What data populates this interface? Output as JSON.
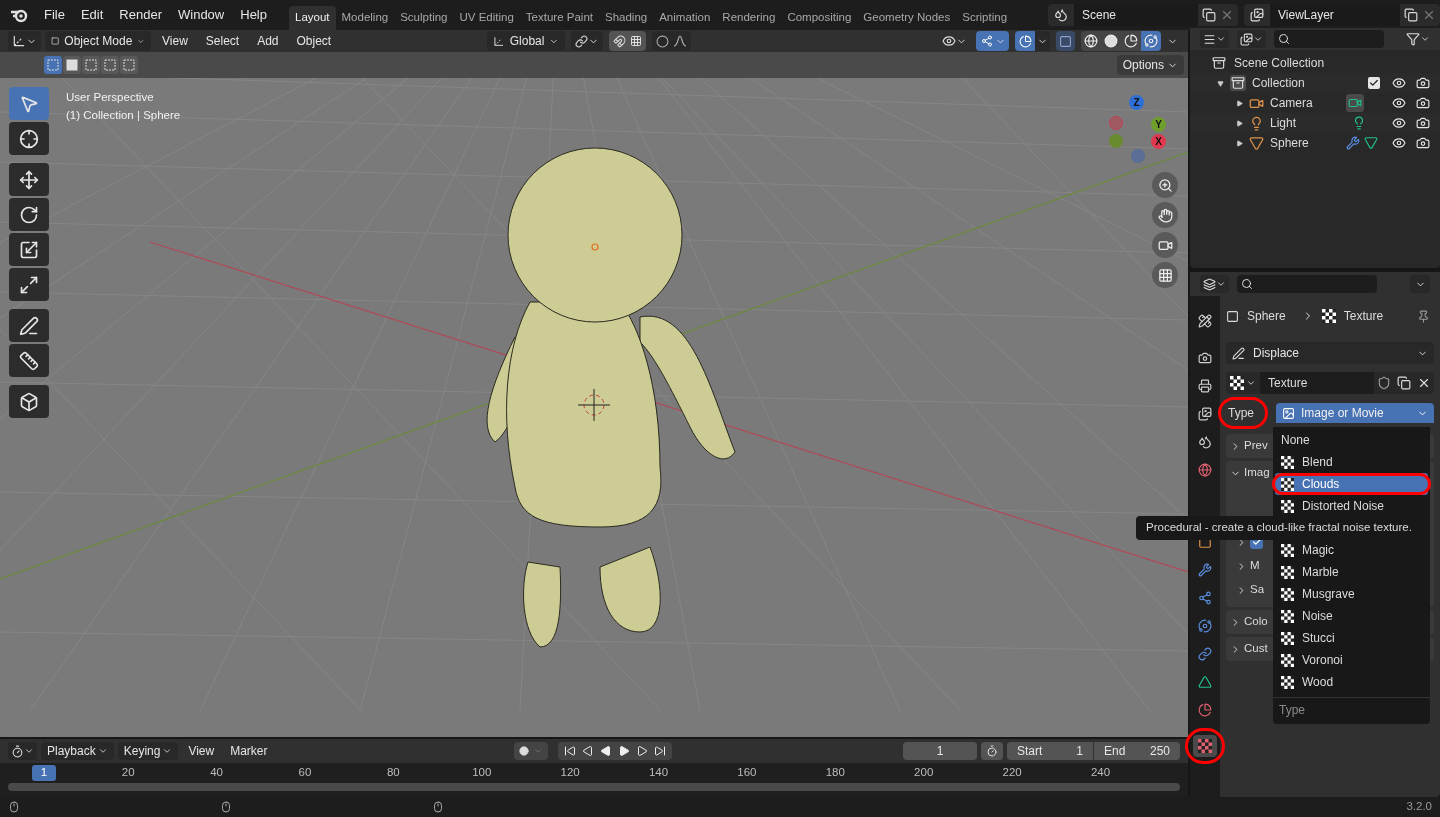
{
  "menu_bar": {
    "menus": [
      "File",
      "Edit",
      "Render",
      "Window",
      "Help"
    ],
    "workspaces": [
      {
        "label": "Layout",
        "selected": true
      },
      {
        "label": "Modeling",
        "selected": false
      },
      {
        "label": "Sculpting",
        "selected": false
      },
      {
        "label": "UV Editing",
        "selected": false
      },
      {
        "label": "Texture Paint",
        "selected": false
      },
      {
        "label": "Shading",
        "selected": false
      },
      {
        "label": "Animation",
        "selected": false
      },
      {
        "label": "Rendering",
        "selected": false
      },
      {
        "label": "Compositing",
        "selected": false
      },
      {
        "label": "Geometry Nodes",
        "selected": false
      },
      {
        "label": "Scripting",
        "selected": false
      }
    ],
    "scene": "Scene",
    "view_layer": "ViewLayer"
  },
  "viewport_header": {
    "mode": "Object Mode",
    "menus": [
      "View",
      "Select",
      "Add",
      "Object"
    ],
    "orientation": "Global",
    "snap_on": true,
    "gizmos_on": true,
    "overlays_on": true,
    "shading_modes": [
      {
        "kind": "wireframe",
        "selected": false
      },
      {
        "kind": "solid",
        "selected": false
      },
      {
        "kind": "material",
        "selected": false
      },
      {
        "kind": "rendered",
        "selected": true
      }
    ]
  },
  "tool_header": {
    "select_modes": [
      {
        "selected": true
      },
      {
        "selected": false
      },
      {
        "selected": false
      },
      {
        "selected": false
      },
      {
        "selected": false
      }
    ],
    "options": "Options"
  },
  "viewport": {
    "overlay_lines": [
      "User Perspective",
      "(1) Collection | Sphere"
    ],
    "gizmo_axes": [
      {
        "label": "Z",
        "color": "#2e6fd6"
      },
      {
        "label": "Y",
        "color": "#6f9e2b"
      },
      {
        "label": "X",
        "color": "#e0394f"
      }
    ],
    "tools": [
      {
        "kind": "select",
        "selected": true
      },
      {
        "kind": "cursor",
        "selected": false
      },
      {
        "kind": "move",
        "selected": false
      },
      {
        "kind": "rotate",
        "selected": false
      },
      {
        "kind": "scale",
        "selected": false
      },
      {
        "kind": "transform",
        "selected": false
      },
      {
        "kind": "annotate",
        "selected": false
      },
      {
        "kind": "measure",
        "selected": false
      },
      {
        "kind": "add-cube",
        "selected": false
      }
    ]
  },
  "outliner": {
    "scene_collection": "Scene Collection",
    "collection": {
      "label": "Collection",
      "expanded": true,
      "checked": true,
      "children": [
        {
          "label": "Camera",
          "kind": "camera"
        },
        {
          "label": "Light",
          "kind": "light"
        },
        {
          "label": "Sphere",
          "kind": "mesh"
        }
      ]
    }
  },
  "properties": {
    "tabs": [
      {
        "kind": "tool",
        "selected": false,
        "highlighted": false
      },
      {
        "kind": "render",
        "selected": false,
        "highlighted": false
      },
      {
        "kind": "output",
        "selected": false,
        "highlighted": false
      },
      {
        "kind": "view-layer",
        "selected": false,
        "highlighted": false
      },
      {
        "kind": "scene",
        "selected": false,
        "highlighted": false
      },
      {
        "kind": "world",
        "selected": false,
        "highlighted": false
      },
      {
        "kind": "object",
        "selected": false,
        "highlighted": false
      },
      {
        "kind": "modifier",
        "selected": false,
        "highlighted": false
      },
      {
        "kind": "particles",
        "selected": false,
        "highlighted": false
      },
      {
        "kind": "physics",
        "selected": false,
        "highlighted": false
      },
      {
        "kind": "constraints",
        "selected": false,
        "highlighted": false
      },
      {
        "kind": "data",
        "selected": false,
        "highlighted": false
      },
      {
        "kind": "material",
        "selected": false,
        "highlighted": false
      },
      {
        "kind": "texture",
        "selected": true,
        "highlighted": true
      }
    ],
    "breadcrumb": [
      "Sphere",
      "Texture"
    ],
    "modifier": "Displace",
    "texture": "Texture",
    "type_label": {
      "text": "Type",
      "highlighted": true
    },
    "type_value": "Image or Movie",
    "panels": [
      {
        "label": "Prev",
        "expanded": false
      },
      {
        "label": "Imag",
        "expanded": true,
        "children": [
          {
            "kind": "checkbox",
            "checked": true
          },
          {
            "kind": "plain",
            "label": "M"
          },
          {
            "kind": "plain",
            "label": "Sa"
          }
        ]
      },
      {
        "label": "Colo",
        "expanded": false
      },
      {
        "label": "Cust",
        "expanded": false
      }
    ]
  },
  "type_menu": {
    "items": [
      {
        "label": "None",
        "kind": "none",
        "selected": false,
        "highlighted": false
      },
      {
        "label": "Blend",
        "kind": "texture",
        "selected": false,
        "highlighted": false
      },
      {
        "label": "Clouds",
        "kind": "texture",
        "selected": true,
        "highlighted": true
      },
      {
        "label": "Distorted Noise",
        "kind": "texture",
        "selected": false,
        "highlighted": false
      },
      {
        "label": "Magic",
        "kind": "texture",
        "selected": false,
        "highlighted": false
      },
      {
        "label": "Marble",
        "kind": "texture",
        "selected": false,
        "highlighted": false
      },
      {
        "label": "Musgrave",
        "kind": "texture",
        "selected": false,
        "highlighted": false
      },
      {
        "label": "Noise",
        "kind": "texture",
        "selected": false,
        "highlighted": false
      },
      {
        "label": "Stucci",
        "kind": "texture",
        "selected": false,
        "highlighted": false
      },
      {
        "label": "Voronoi",
        "kind": "texture",
        "selected": false,
        "highlighted": false
      },
      {
        "label": "Wood",
        "kind": "texture",
        "selected": false,
        "highlighted": false
      }
    ],
    "footer": "Type"
  },
  "tooltip": "Procedural - create a cloud-like fractal noise texture.",
  "timeline": {
    "menus": [
      "Playback",
      "Keying",
      "View",
      "Marker"
    ],
    "current_frame": "1",
    "start_label": "Start",
    "start": "1",
    "end_label": "End",
    "end": "250",
    "ticks": [
      {
        "label": "1",
        "selected": true
      },
      {
        "label": "20",
        "selected": false
      },
      {
        "label": "40",
        "selected": false
      },
      {
        "label": "60",
        "selected": false
      },
      {
        "label": "80",
        "selected": false
      },
      {
        "label": "100",
        "selected": false
      },
      {
        "label": "120",
        "selected": false
      },
      {
        "label": "140",
        "selected": false
      },
      {
        "label": "160",
        "selected": false
      },
      {
        "label": "180",
        "selected": false
      },
      {
        "label": "200",
        "selected": false
      },
      {
        "label": "220",
        "selected": false
      },
      {
        "label": "240",
        "selected": false
      }
    ]
  },
  "status_bar": {
    "version": "3.2.0"
  }
}
